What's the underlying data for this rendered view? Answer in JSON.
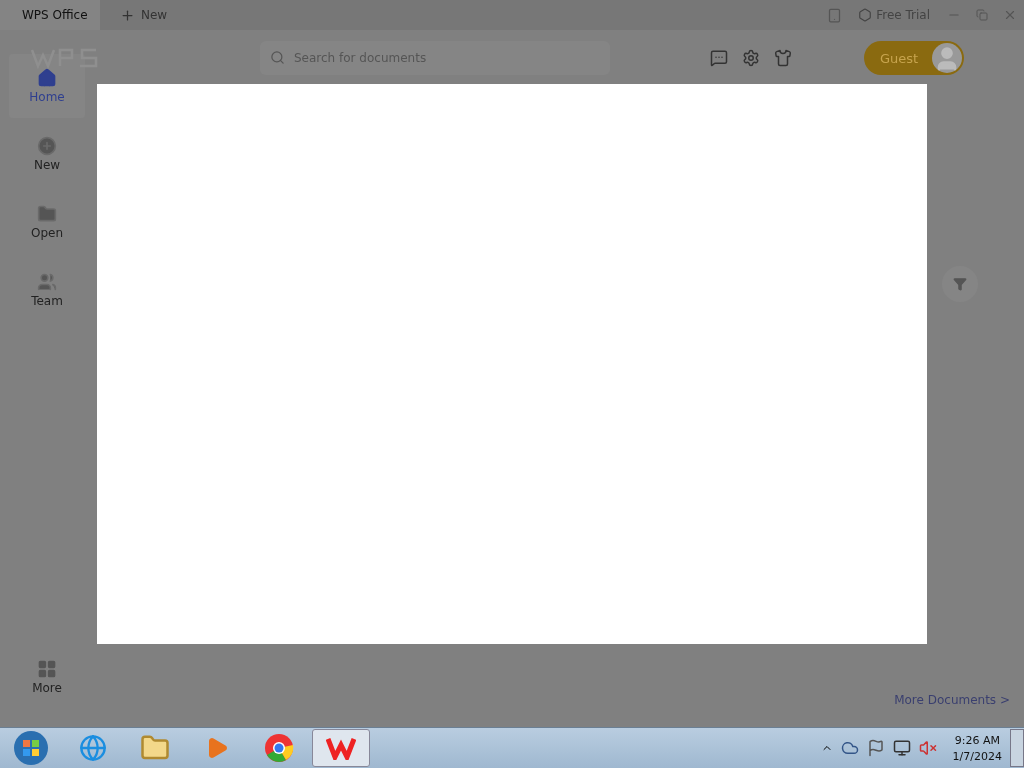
{
  "title_bar": {
    "tabs": [
      {
        "label": "WPS Office",
        "selected": true
      }
    ],
    "new_tab": "New",
    "free_trial": "Free Trial"
  },
  "header": {
    "search": {
      "placeholder": "Search for documents"
    },
    "account": "Guest"
  },
  "sidebar": {
    "items": [
      {
        "label": "Home",
        "selected": true
      },
      {
        "label": "New",
        "selected": false
      },
      {
        "label": "Open",
        "selected": false
      },
      {
        "label": "Team",
        "selected": false
      }
    ],
    "more": "More"
  },
  "more_documents": "More Documents >",
  "taskbar": {
    "time": "9:26 AM",
    "date": "1/7/2024"
  }
}
